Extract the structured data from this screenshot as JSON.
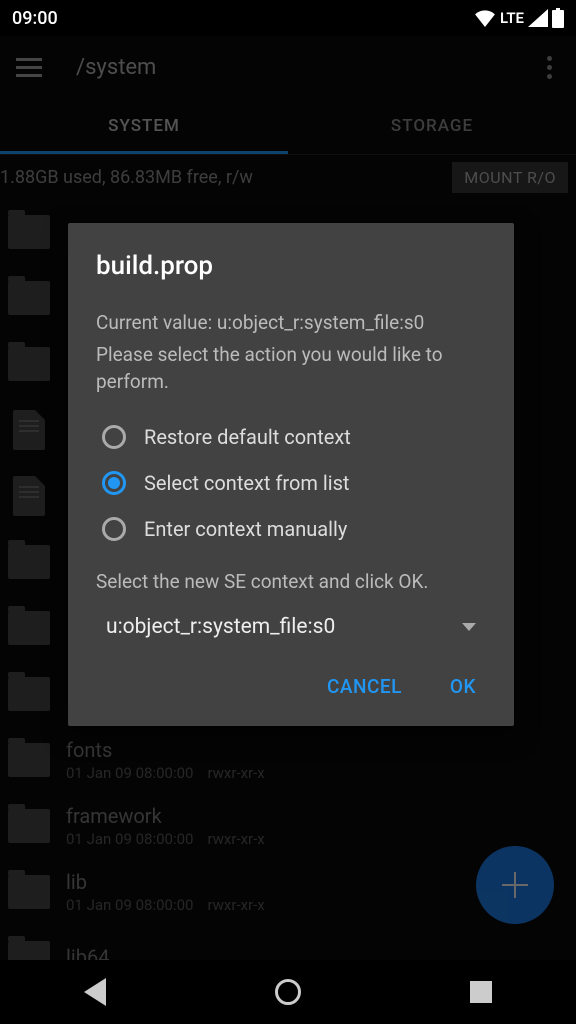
{
  "status": {
    "time": "09:00",
    "network": "LTE"
  },
  "appbar": {
    "path": "/system"
  },
  "tabs": [
    {
      "label": "SYSTEM",
      "active": true
    },
    {
      "label": "STORAGE",
      "active": false
    }
  ],
  "storage": {
    "info": "1.88GB used, 86.83MB free, r/w",
    "mount_label": "MOUNT R/O"
  },
  "files": [
    {
      "type": "folder",
      "name": "",
      "date": "",
      "perms": ""
    },
    {
      "type": "folder",
      "name": "",
      "date": "",
      "perms": ""
    },
    {
      "type": "folder",
      "name": "",
      "date": "",
      "perms": ""
    },
    {
      "type": "file",
      "name": "",
      "date": "",
      "perms": ""
    },
    {
      "type": "file",
      "name": "",
      "date": "",
      "perms": ""
    },
    {
      "type": "folder",
      "name": "",
      "date": "",
      "perms": ""
    },
    {
      "type": "folder",
      "name": "",
      "date": "",
      "perms": ""
    },
    {
      "type": "folder",
      "name": "",
      "date": "",
      "perms": ""
    },
    {
      "type": "folder",
      "name": "fonts",
      "date": "01 Jan 09 08:00:00",
      "perms": "rwxr-xr-x"
    },
    {
      "type": "folder",
      "name": "framework",
      "date": "01 Jan 09 08:00:00",
      "perms": "rwxr-xr-x"
    },
    {
      "type": "folder",
      "name": "lib",
      "date": "01 Jan 09 08:00:00",
      "perms": "rwxr-xr-x"
    },
    {
      "type": "folder",
      "name": "lib64",
      "date": "",
      "perms": ""
    }
  ],
  "dialog": {
    "title": "build.prop",
    "current_value": "Current value: u:object_r:system_file:s0",
    "instruction": "Please select the action you would like to perform.",
    "options": [
      {
        "label": "Restore default context",
        "selected": false
      },
      {
        "label": "Select context from list",
        "selected": true
      },
      {
        "label": "Enter context manually",
        "selected": false
      }
    ],
    "select_hint": "Select the new SE context and click OK.",
    "dropdown_value": "u:object_r:system_file:s0",
    "cancel": "CANCEL",
    "ok": "OK"
  }
}
